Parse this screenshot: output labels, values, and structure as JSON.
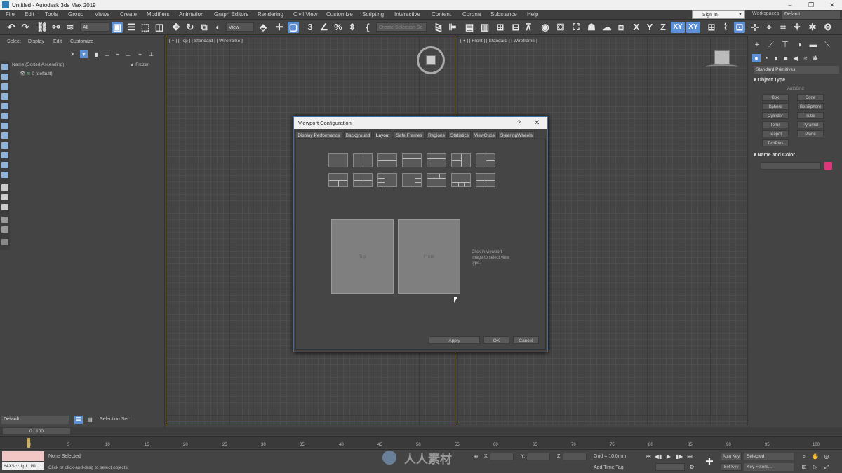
{
  "window": {
    "title": "Untitled - Autodesk 3ds Max 2019",
    "minimize": "–",
    "maximize": "❐",
    "close": "✕"
  },
  "menu": {
    "items": [
      "File",
      "Edit",
      "Tools",
      "Group",
      "Views",
      "Create",
      "Modifiers",
      "Animation",
      "Graph Editors",
      "Rendering",
      "Civil View",
      "Customize",
      "Scripting",
      "Interactive",
      "Content",
      "Corona",
      "Substance",
      "Help"
    ],
    "sign_in": "Sign In",
    "workspaces_label": "Workspaces:",
    "workspace_value": "Default"
  },
  "toolbar": {
    "selection_filter": "All",
    "reference_coord": "View",
    "named_selection": "Create Selection Se",
    "axis_labels": [
      "X",
      "Y",
      "Z",
      "XY",
      "XY"
    ]
  },
  "explorer": {
    "tabs": [
      "Select",
      "Display",
      "Edit",
      "Customize"
    ],
    "column_name": "Name (Sorted Ascending)",
    "column_frozen": "▲ Frozen",
    "root_item": "0 (default)"
  },
  "viewports": {
    "top_label": "[ + ] [ Top ] [ Standard ] [ Wireframe ]",
    "front_label": "[ + ] [ Front ] [ Standard ] [ Wireframe ]"
  },
  "command_panel": {
    "category": "Standard Primitives",
    "object_type_header": "Object Type",
    "autogrid": "AutoGrid",
    "objects": [
      "Box",
      "Cone",
      "Sphere",
      "GeoSphere",
      "Cylinder",
      "Tube",
      "Torus",
      "Pyramid",
      "Teapot",
      "Plane",
      "TextPlus"
    ],
    "name_color_header": "Name and Color",
    "swatch_color": "#e0357a"
  },
  "dialog": {
    "title": "Viewport Configuration",
    "help": "?",
    "close": "✕",
    "tabs": [
      "Display Performance",
      "Background",
      "Layout",
      "Safe Frames",
      "Regions",
      "Statistics",
      "ViewCube",
      "SteeringWheels"
    ],
    "active_tab": "Layout",
    "preview_left": "Top",
    "preview_right": "Front",
    "hint": "Click in viewport image to select view type.",
    "apply": "Apply",
    "ok": "OK",
    "cancel": "Cancel"
  },
  "bottom": {
    "layer": "Default",
    "selection_set": "Selection Set:",
    "frame_counter": "0 / 100",
    "ticks": [
      "0",
      "5",
      "10",
      "15",
      "20",
      "25",
      "30",
      "35",
      "40",
      "45",
      "50",
      "55",
      "60",
      "65",
      "70",
      "75",
      "80",
      "85",
      "90",
      "95",
      "100"
    ],
    "maxscript": "MAXScript Mi",
    "status_main": "None Selected",
    "status_prompt": "Click or click-and-drag to select objects",
    "coord_x": "X:",
    "coord_y": "Y:",
    "coord_z": "Z:",
    "grid": "Grid = 10.0mm",
    "add_time_tag": "Add Time Tag",
    "auto_key": "Auto Key",
    "set_key": "Set Key",
    "selected": "Selected",
    "key_filters": "Key Filters...",
    "watermark": "人人素材"
  }
}
